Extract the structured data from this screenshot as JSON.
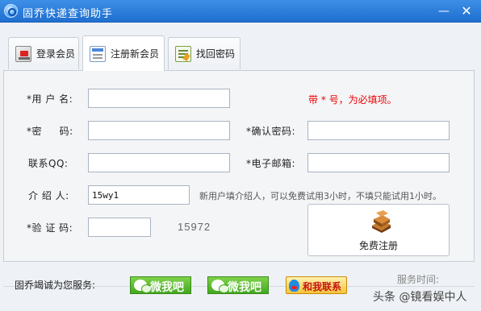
{
  "window": {
    "title": "固乔快递查询助手",
    "minimize": "—",
    "close": "✕"
  },
  "tabs": [
    {
      "label": "登录会员",
      "icon": "login-card-icon"
    },
    {
      "label": "注册新会员",
      "icon": "register-form-icon",
      "active": true
    },
    {
      "label": "找回密码",
      "icon": "recover-note-icon"
    }
  ],
  "form": {
    "username_label": "*用 户 名:",
    "password_label": "*密     码:",
    "confirm_label": "*确认密码:",
    "qq_label": "联系QQ:",
    "email_label": "*电子邮箱:",
    "referrer_label": "介 绍 人:",
    "referrer_value": "15wy1",
    "captcha_label": "*验 证 码:",
    "captcha_code": "15972",
    "required_hint": "带 * 号，为必填项。",
    "referrer_hint": "新用户填介绍人，可以免费试用3小时，不填只能试用1小时。",
    "register_button": "免费注册"
  },
  "footer": {
    "service_label": "固乔竭诚为您服务:",
    "wechat1": "微我吧",
    "wechat2": "微我吧",
    "contact": "和我联系",
    "service_time": "服务时间:",
    "watermark": "头条 @镜看娱中人"
  },
  "colors": {
    "titlebar": "#1f6fd0",
    "required": "#e00000",
    "wechat": "#43a81f"
  }
}
